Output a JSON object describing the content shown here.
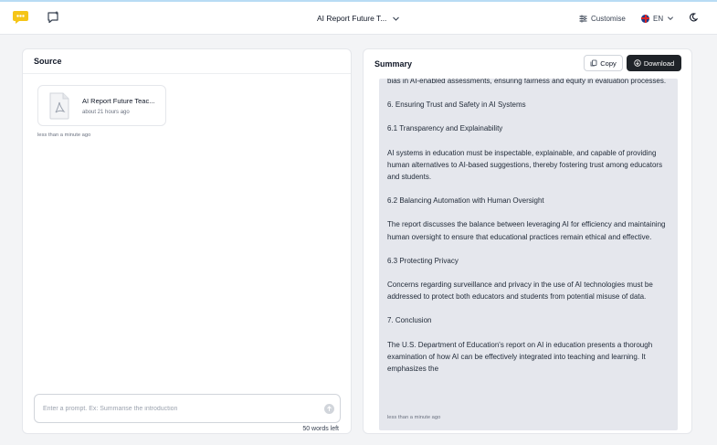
{
  "header": {
    "doc_title": "AI Report Future T...",
    "customise_label": "Customise",
    "language": "EN"
  },
  "source": {
    "title": "Source",
    "file": {
      "name": "AI Report Future Teac...",
      "time": "about 21 hours ago"
    },
    "time": "less than a minute ago",
    "prompt": {
      "placeholder": "Enter a prompt. Ex: Summarise the introduction",
      "value": ""
    },
    "words_left": "50 words left"
  },
  "summary": {
    "title": "Summary",
    "copy_label": "Copy",
    "download_label": "Download",
    "paragraphs": [
      "bias in AI-enabled assessments, ensuring fairness and equity in evaluation processes.",
      "6. Ensuring Trust and Safety in AI Systems",
      "6.1 Transparency and Explainability",
      "AI systems in education must be inspectable, explainable, and capable of providing human alternatives to AI-based suggestions, thereby fostering trust among educators and students.",
      "6.2 Balancing Automation with Human Oversight",
      "The report discusses the balance between leveraging AI for efficiency and maintaining human oversight to ensure that educational practices remain ethical and effective.",
      "6.3 Protecting Privacy",
      "Concerns regarding surveillance and privacy in the use of AI technologies must be addressed to protect both educators and students from potential misuse of data.",
      "7. Conclusion",
      "The U.S. Department of Education's report on AI in education presents a thorough examination of how AI can be effectively integrated into teaching and learning. It emphasizes the"
    ],
    "time": "less than a minute ago"
  },
  "colors": {
    "logo": "#f5c518",
    "download_bg": "#1f2328",
    "summary_bg": "#e5e7ed"
  },
  "icons": {
    "logo": "logo-icon",
    "new_chat": "new-chat-icon",
    "chevron": "chevron-down-icon",
    "customise": "sliders-icon",
    "flag": "uk-flag-icon",
    "theme": "moon-icon",
    "pdf": "pdf-file-icon",
    "send": "send-icon",
    "copy": "copy-icon",
    "download": "download-icon"
  }
}
